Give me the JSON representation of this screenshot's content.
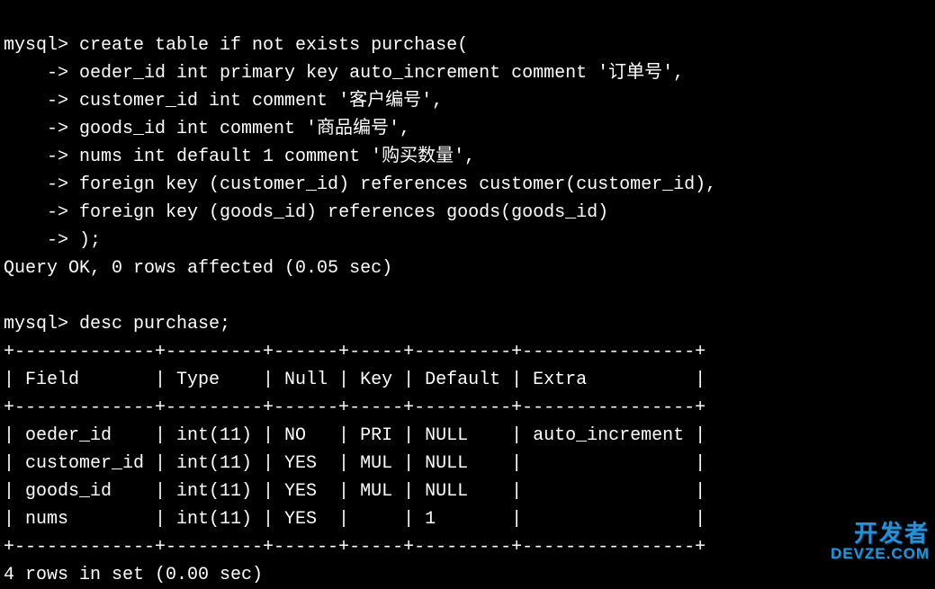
{
  "prompt_main": "mysql> ",
  "prompt_cont": "    -> ",
  "create_lines": [
    "create table if not exists purchase(",
    "oeder_id int primary key auto_increment comment '订单号',",
    "customer_id int comment '客户编号',",
    "goods_id int comment '商品编号',",
    "nums int default 1 comment '购买数量',",
    "foreign key (customer_id) references customer(customer_id),",
    "foreign key (goods_id) references goods(goods_id)",
    ");"
  ],
  "query_ok": "Query OK, 0 rows affected (0.05 sec)",
  "blank": "",
  "desc_cmd": "desc purchase;",
  "table_border": "+-------------+---------+------+-----+---------+----------------+",
  "header_row": "| Field       | Type    | Null | Key | Default | Extra          |",
  "rows": [
    "| oeder_id    | int(11) | NO   | PRI | NULL    | auto_increment |",
    "| customer_id | int(11) | YES  | MUL | NULL    |                |",
    "| goods_id    | int(11) | YES  | MUL | NULL    |                |",
    "| nums        | int(11) | YES  |     | 1       |                |"
  ],
  "rows_summary": "4 rows in set (0.00 sec)",
  "chart_data": {
    "type": "table",
    "title": "desc purchase",
    "columns": [
      "Field",
      "Type",
      "Null",
      "Key",
      "Default",
      "Extra"
    ],
    "data": [
      {
        "Field": "oeder_id",
        "Type": "int(11)",
        "Null": "NO",
        "Key": "PRI",
        "Default": "NULL",
        "Extra": "auto_increment"
      },
      {
        "Field": "customer_id",
        "Type": "int(11)",
        "Null": "YES",
        "Key": "MUL",
        "Default": "NULL",
        "Extra": ""
      },
      {
        "Field": "goods_id",
        "Type": "int(11)",
        "Null": "YES",
        "Key": "MUL",
        "Default": "NULL",
        "Extra": ""
      },
      {
        "Field": "nums",
        "Type": "int(11)",
        "Null": "YES",
        "Key": "",
        "Default": "1",
        "Extra": ""
      }
    ]
  },
  "watermark": {
    "top": "开发者",
    "bot": "DEVZE.COM"
  }
}
